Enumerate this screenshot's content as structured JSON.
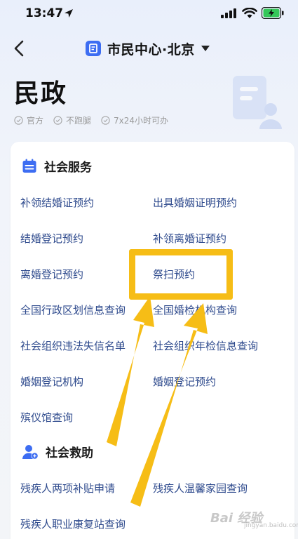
{
  "status_bar": {
    "time": "13:47"
  },
  "nav": {
    "title": "市民中心·北京"
  },
  "header": {
    "title": "民政",
    "tags": [
      "官方",
      "不跑腿",
      "7x24小时可办"
    ]
  },
  "sections": [
    {
      "title": "社会服务",
      "items": [
        "补领结婚证预约",
        "出具婚姻证明预约",
        "结婚登记预约",
        "补领离婚证预约",
        "离婚登记预约",
        "祭扫预约",
        "全国行政区划信息查询",
        "全国婚检机构查询",
        "社会组织违法失信名单",
        "社会组织年检信息查询",
        "婚姻登记机构",
        "婚姻登记预约",
        "殡仪馆查询"
      ]
    },
    {
      "title": "社会救助",
      "items": [
        "残疾人两项补贴申请",
        "残疾人温馨家园查询",
        "残疾人职业康复站查询"
      ]
    }
  ],
  "annotation": {
    "highlighted_item": "祭扫预约",
    "highlight_color": "#f6bd16"
  },
  "watermark": {
    "text": "Bai 经验",
    "sub": "jingyan.baidu.com"
  },
  "colors": {
    "accent": "#3d6df2",
    "link": "#2e4a8d"
  }
}
